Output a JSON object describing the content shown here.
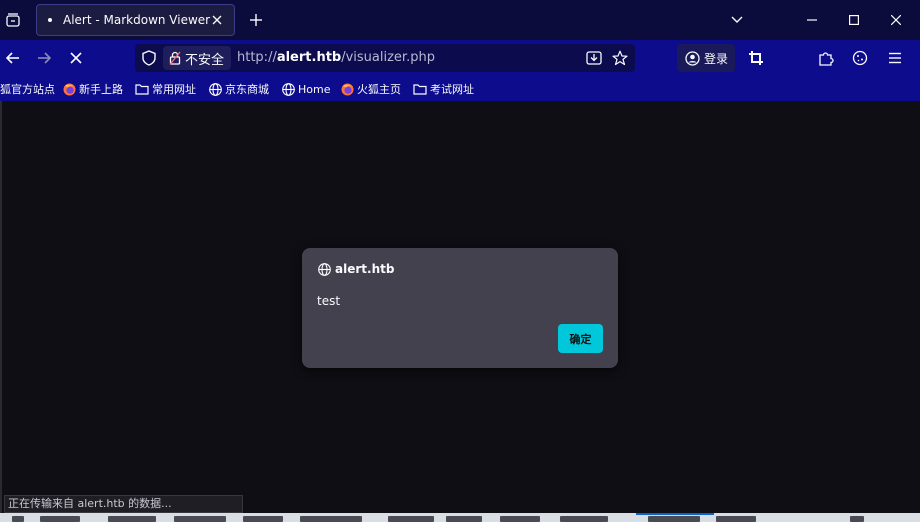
{
  "browser": {
    "tab": {
      "title": "Alert - Markdown Viewer"
    },
    "toolbar": {
      "insecure_label": "不安全",
      "url_prefix": "http://",
      "url_host": "alert.htb",
      "url_path": "/visualizer.php",
      "login_label": "登录"
    },
    "bookmarks": [
      {
        "label": "狐官方站点",
        "icon": "firefox-icon"
      },
      {
        "label": "新手上路",
        "icon": "firefox-icon"
      },
      {
        "label": "常用网址",
        "icon": "folder-icon"
      },
      {
        "label": "京东商城",
        "icon": "globe-icon"
      },
      {
        "label": "Home",
        "icon": "globe-icon"
      },
      {
        "label": "火狐主页",
        "icon": "firefox-icon"
      },
      {
        "label": "考试网址",
        "icon": "folder-icon"
      }
    ]
  },
  "dialog": {
    "origin": "alert.htb",
    "message": "test",
    "ok_label": "确定"
  },
  "status": {
    "text": "正在传输来自 alert.htb 的数据..."
  },
  "colors": {
    "tabstrip": "#0b0b3c",
    "navbar": "#0c0c8c",
    "page_background": "#0e0e14",
    "dialog_background": "#42414d",
    "ok_button": "#00c7d9"
  }
}
